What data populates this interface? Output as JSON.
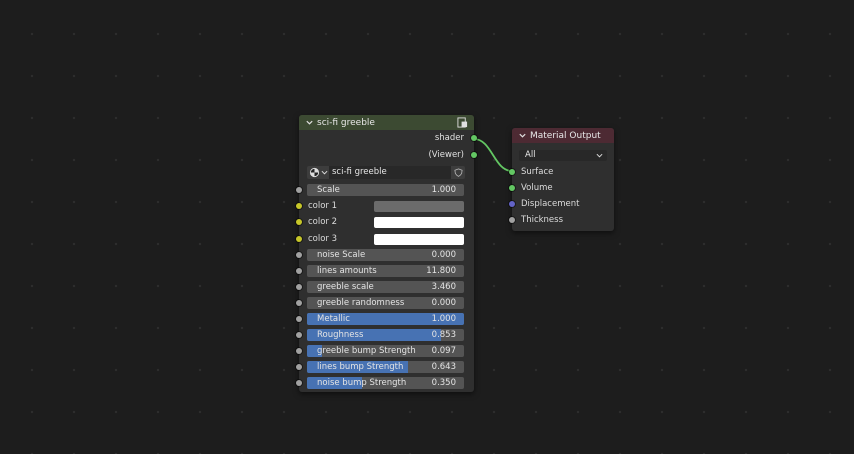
{
  "group_node": {
    "title": "sci-fi greeble",
    "header_color": "#3c4a32",
    "outputs": [
      {
        "label": "shader",
        "socket_color": "#63c763"
      },
      {
        "label": "(Viewer)",
        "socket_color": "#63c763"
      }
    ],
    "datablock": {
      "name": "sci-fi greeble",
      "icon": "node-tree-icon"
    },
    "inputs": [
      {
        "kind": "value",
        "label": "Scale",
        "value": "1.000",
        "socket_color": "#a1a1a1",
        "fill": 0
      },
      {
        "kind": "color",
        "label": "color 1",
        "socket_color": "#c7c729",
        "swatch": "#6b6b6b"
      },
      {
        "kind": "color",
        "label": "color 2",
        "socket_color": "#c7c729",
        "swatch": "#ffffff"
      },
      {
        "kind": "color",
        "label": "color 3",
        "socket_color": "#c7c729",
        "swatch": "#ffffff"
      },
      {
        "kind": "value",
        "label": "noise Scale",
        "value": "0.000",
        "socket_color": "#a1a1a1",
        "fill": 0
      },
      {
        "kind": "value",
        "label": "lines amounts",
        "value": "11.800",
        "socket_color": "#a1a1a1",
        "fill": 0
      },
      {
        "kind": "value",
        "label": "greeble scale",
        "value": "3.460",
        "socket_color": "#a1a1a1",
        "fill": 0
      },
      {
        "kind": "value",
        "label": "greeble randomness",
        "value": "0.000",
        "socket_color": "#a1a1a1",
        "fill": 0
      },
      {
        "kind": "factor",
        "label": "Metallic",
        "value": "1.000",
        "socket_color": "#a1a1a1",
        "fill": 1.0
      },
      {
        "kind": "factor",
        "label": "Roughness",
        "value": "0.853",
        "socket_color": "#a1a1a1",
        "fill": 0.853
      },
      {
        "kind": "factor",
        "label": "greeble bump Strength",
        "value": "0.097",
        "socket_color": "#a1a1a1",
        "fill": 0.097
      },
      {
        "kind": "factor",
        "label": "lines bump Strength",
        "value": "0.643",
        "socket_color": "#a1a1a1",
        "fill": 0.643
      },
      {
        "kind": "factor",
        "label": "noise bump Strength",
        "value": "0.350",
        "socket_color": "#a1a1a1",
        "fill": 0.35
      }
    ]
  },
  "output_node": {
    "title": "Material Output",
    "header_color": "#4d2a33",
    "target": "All",
    "inputs": [
      {
        "label": "Surface",
        "socket_color": "#63c763"
      },
      {
        "label": "Volume",
        "socket_color": "#63c763"
      },
      {
        "label": "Displacement",
        "socket_color": "#6363c7"
      },
      {
        "label": "Thickness",
        "socket_color": "#a1a1a1"
      }
    ]
  },
  "link_color": "#63c763"
}
